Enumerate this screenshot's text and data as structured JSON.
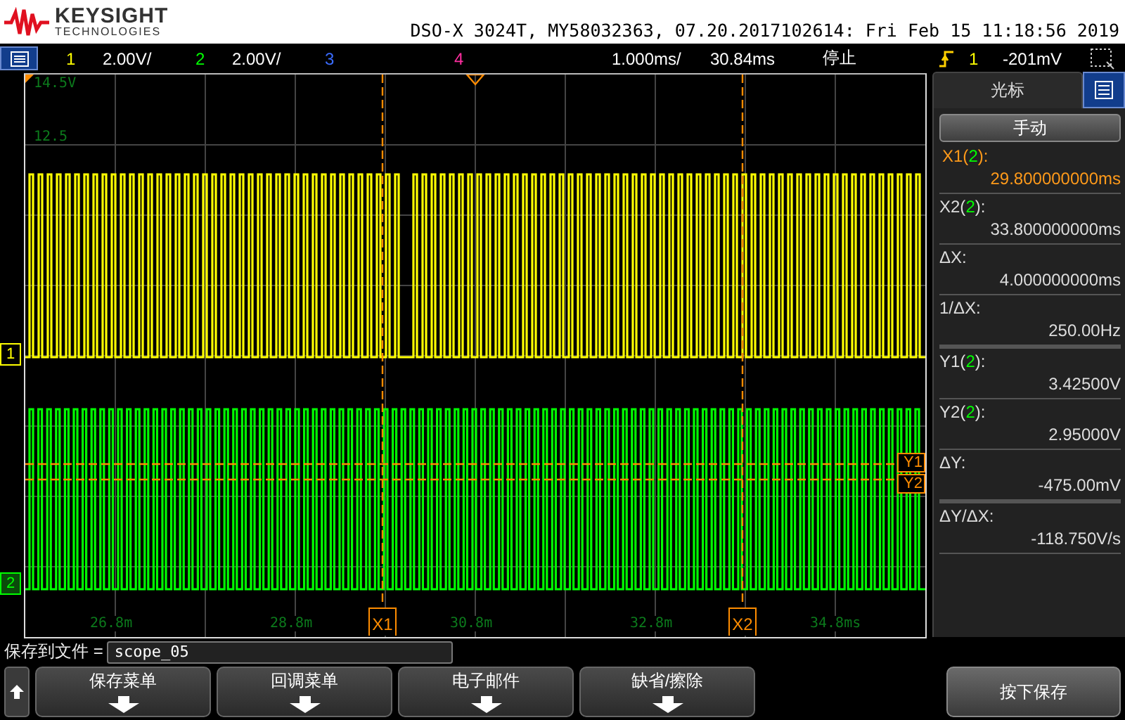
{
  "header": {
    "brand": "KEYSIGHT",
    "brand_sub": "TECHNOLOGIES",
    "title": "DSO-X 3024T, MY58032363, 07.20.2017102614: Fri Feb 15 11:18:56 2019"
  },
  "channel_bar": {
    "channels": [
      {
        "number": "1",
        "scale": "2.00V/",
        "color": "#ffff00"
      },
      {
        "number": "2",
        "scale": "2.00V/",
        "color": "#00ff00"
      },
      {
        "number": "3",
        "color": "#3a6cff"
      },
      {
        "number": "4",
        "color": "#ff2ea0"
      }
    ],
    "timebase": "1.000ms/",
    "delay": "30.84ms",
    "run_state": "停止",
    "trigger_source": "1",
    "trigger_level": "-201mV"
  },
  "display": {
    "grid_labels": [
      "14.5V",
      "12.5"
    ],
    "time_labels": [
      "26.8m",
      "28.8m",
      "30.8m",
      "32.8m",
      "34.8ms"
    ],
    "ground_markers": [
      {
        "label": "1",
        "color": "#ffff00"
      },
      {
        "label": "2",
        "color": "#00ff00"
      }
    ],
    "cursors": [
      {
        "kind": "x",
        "label": "X1"
      },
      {
        "kind": "x",
        "label": "X2"
      },
      {
        "kind": "y",
        "label": "Y1"
      },
      {
        "kind": "y",
        "label": "Y2"
      }
    ]
  },
  "side_panel": {
    "tab": "光标",
    "mode_button": "手动",
    "readouts": [
      {
        "prefix": "X1(",
        "channel": "2",
        "suffix": "):",
        "value": "29.800000000ms",
        "selected": true,
        "group_end": false
      },
      {
        "prefix": "X2(",
        "channel": "2",
        "suffix": "):",
        "value": "33.800000000ms",
        "selected": false,
        "group_end": false
      },
      {
        "prefix": "ΔX:",
        "value": "4.000000000ms",
        "selected": false,
        "group_end": false
      },
      {
        "prefix": "1/ΔX:",
        "value": "250.00Hz",
        "selected": false,
        "group_end": true
      },
      {
        "prefix": "Y1(",
        "channel": "2",
        "suffix": "):",
        "value": "3.42500V",
        "selected": false,
        "group_end": false
      },
      {
        "prefix": "Y2(",
        "channel": "2",
        "suffix": "):",
        "value": "2.95000V",
        "selected": false,
        "group_end": false
      },
      {
        "prefix": "ΔY:",
        "value": "-475.00mV",
        "selected": false,
        "group_end": true
      },
      {
        "prefix": "ΔY/ΔX:",
        "value": "-118.750V/s",
        "selected": false,
        "group_end": false
      }
    ]
  },
  "save_row": {
    "label": "保存到文件 =",
    "value": "scope_05"
  },
  "softkeys": [
    {
      "label": "保存菜单"
    },
    {
      "label": "回调菜单"
    },
    {
      "label": "电子邮件"
    },
    {
      "label": "缺省/擦除"
    }
  ],
  "action_button": "按下保存"
}
